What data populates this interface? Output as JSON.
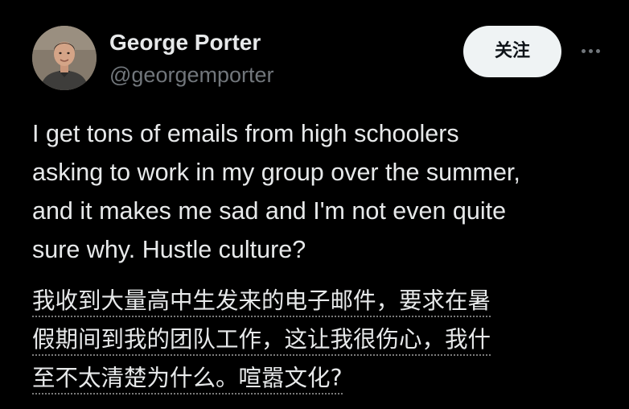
{
  "author": {
    "name": "George Porter",
    "handle": "@georgemporter"
  },
  "actions": {
    "follow_label": "关注",
    "more_icon": "more-horizontal-icon"
  },
  "tweet": {
    "text": "I get tons of emails from high schoolers\nasking to work in my group over the summer,\nand it makes me sad and I'm not even quite\nsure why.  Hustle culture?",
    "translation_lines": [
      "我收到大量高中生发来的电子邮件，要求在暑",
      "假期间到我的团队工作，这让我很伤心，我什",
      "至不太清楚为什么。喧嚣文化?"
    ]
  },
  "colors": {
    "background": "#000000",
    "primary_text": "#e7e9ea",
    "secondary_text": "#71767b",
    "button_bg": "#eff3f4",
    "button_text": "#0f1419"
  }
}
